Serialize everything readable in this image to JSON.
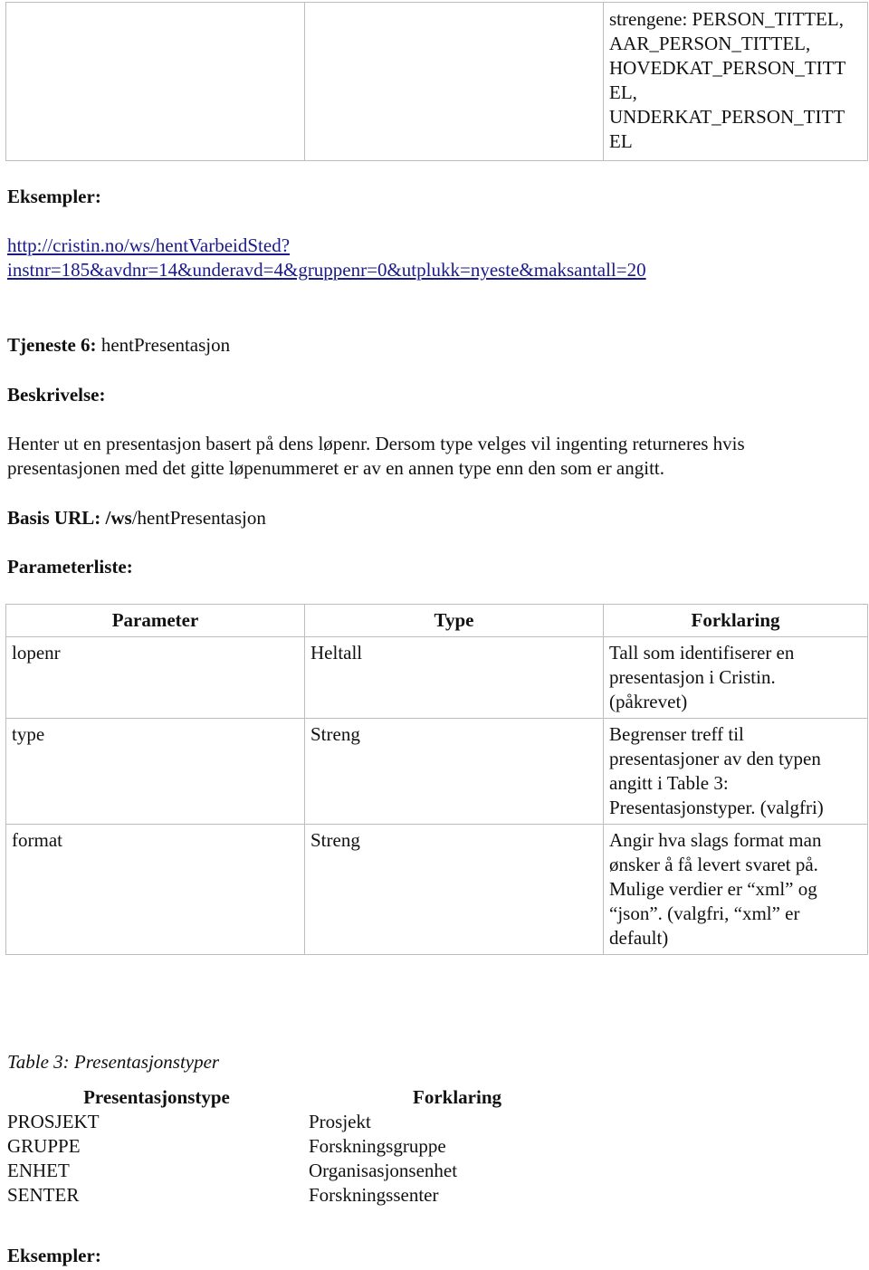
{
  "top_table": {
    "cell3_lines": [
      "strengene: PERSON_TITTEL,",
      "AAR_PERSON_TITTEL,",
      "HOVEDKAT_PERSON_TITT",
      "EL,",
      "UNDERKAT_PERSON_TITT",
      "EL"
    ]
  },
  "examples1": {
    "heading": "Eksempler:",
    "link_line1": "http://cristin.no/ws/hentVarbeidSted?",
    "link_line2": "instnr=185&avdnr=14&underavd=4&gruppenr=0&utplukk=nyeste&maksantall=20"
  },
  "service": {
    "label": "Tjeneste 6:",
    "name": "hentPresentasjon",
    "description_label": "Beskrivelse:",
    "description_line1": "Henter ut en presentasjon basert på dens løpenr. Dersom type velges vil ingenting returneres hvis",
    "description_line2": "presentasjonen med det gitte løpenummeret er av en annen type enn den som er angitt.",
    "base_url_label": "Basis URL: /ws",
    "base_url_rest": "/hentPresentasjon",
    "param_list_label": "Parameterliste:"
  },
  "param_table": {
    "headers": [
      "Parameter",
      "Type",
      "Forklaring"
    ],
    "rows": [
      {
        "param": "lopenr",
        "type": "Heltall",
        "desc_lines": [
          "Tall som identifiserer en",
          "presentasjon i Cristin.",
          "(påkrevet)"
        ]
      },
      {
        "param": "type",
        "type": "Streng",
        "desc_lines": [
          "Begrenser treff til",
          "presentasjoner av den typen",
          "angitt i Table 3:",
          "Presentasjonstyper. (valgfri)"
        ]
      },
      {
        "param": "format",
        "type": "Streng",
        "desc_lines": [
          "Angir hva slags format man",
          "ønsker å få levert svaret på.",
          "Mulige verdier er “xml” og",
          "“json”. (valgfri, “xml” er",
          "default)"
        ]
      }
    ]
  },
  "types_table": {
    "caption": "Table 3: Presentasjonstyper",
    "headers": [
      "Presentasjonstype",
      "Forklaring"
    ],
    "rows": [
      {
        "type": "PROSJEKT",
        "desc": "Prosjekt"
      },
      {
        "type": "GRUPPE",
        "desc": "Forskningsgruppe"
      },
      {
        "type": "ENHET",
        "desc": "Organisasjonsenhet"
      },
      {
        "type": "SENTER",
        "desc": "Forskningssenter"
      }
    ]
  },
  "examples2": {
    "heading": "Eksempler:"
  }
}
